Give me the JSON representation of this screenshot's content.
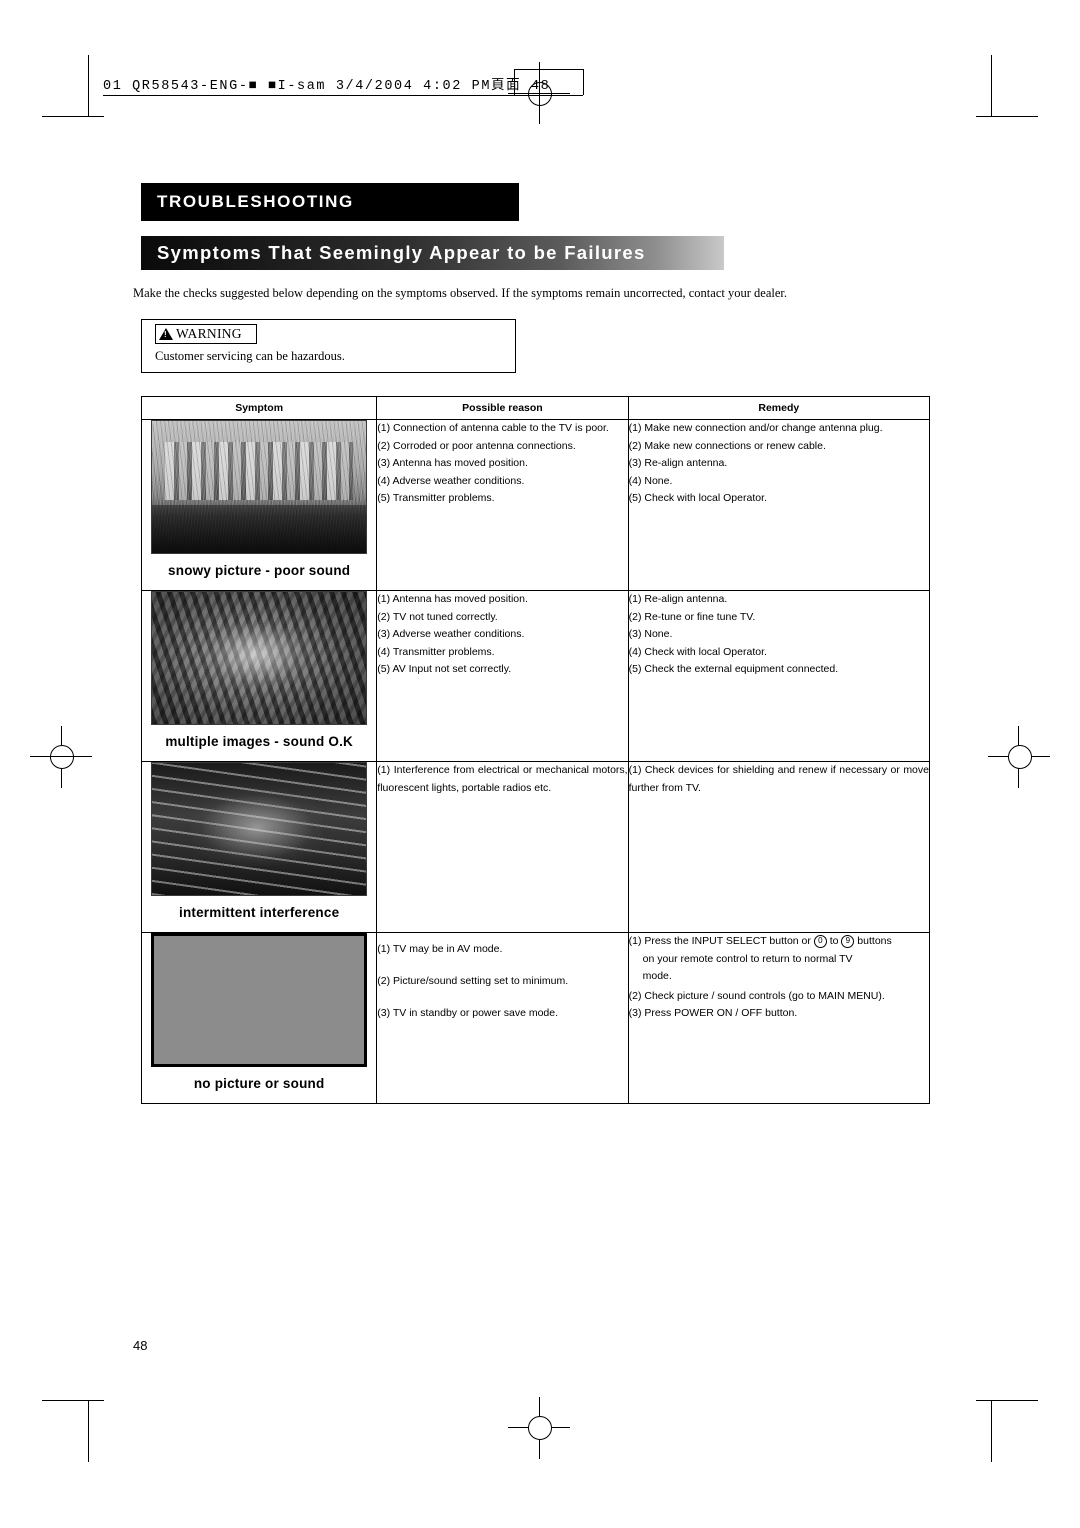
{
  "header": {
    "file_line": "01 QR58543-ENG-■ ■I-sam 3/4/2004 4:02 PM頁面 48"
  },
  "titles": {
    "section": "TROUBLESHOOTING",
    "subsection": "Symptoms That Seemingly Appear to be Failures"
  },
  "intro": "Make the checks suggested below depending on the symptoms observed.  If the symptoms remain uncorrected, contact your dealer.",
  "warning": {
    "label": "WARNING",
    "text": "Customer servicing can be hazardous."
  },
  "table": {
    "headers": [
      "Symptom",
      "Possible reason",
      "Remedy"
    ],
    "rows": [
      {
        "thumb": "snowy-picture-thumbnail",
        "caption": "snowy picture - poor sound",
        "reasons": [
          "(1) Connection of antenna cable to the TV is poor.",
          "(2) Corroded or poor antenna connections.",
          "(3) Antenna has moved position.",
          "(4) Adverse weather conditions.",
          "(5) Transmitter problems."
        ],
        "remedies": [
          "(1) Make new connection and/or change antenna plug.",
          "(2) Make new connections or renew cable.",
          "(3) Re-align antenna.",
          "(4) None.",
          "(5) Check with local Operator."
        ]
      },
      {
        "thumb": "multiple-images-thumbnail",
        "caption": "multiple images - sound O.K",
        "reasons": [
          "(1) Antenna has moved position.",
          "(2) TV not tuned correctly.",
          "(3) Adverse weather conditions.",
          "(4) Transmitter problems.",
          "(5) AV Input not set correctly."
        ],
        "remedies": [
          "(1) Re-align antenna.",
          "(2) Re-tune or fine tune TV.",
          "(3) None.",
          "(4) Check with local Operator.",
          "(5) Check the external equipment connected."
        ]
      },
      {
        "thumb": "intermittent-interference-thumbnail",
        "caption": "intermittent interference",
        "reasons": [
          "(1) Interference from electrical or mechanical motors, fluorescent lights, portable radios etc."
        ],
        "remedies": [
          "(1) Check devices for shielding and renew if necessary or move further from TV."
        ]
      },
      {
        "thumb": "no-picture-thumbnail",
        "caption": "no picture or sound",
        "reasons": [
          "(1) TV may be in AV mode.",
          "(2) Picture/sound setting set to minimum.",
          "(3) TV in standby or power save mode."
        ],
        "remedies": [
          "(1) Press the INPUT SELECT button or 0 to 9 buttons on your remote control to return to normal TV mode.",
          "(2) Check picture / sound controls (go to  MAIN MENU).",
          "(3) Press POWER ON / OFF button."
        ],
        "remedy1_parts": {
          "pre": "(1) Press the INPUT SELECT button or ",
          "digit_a": "0",
          "mid": " to ",
          "digit_b": "9",
          "post": " buttons",
          "line2": "on your remote control to return to normal TV",
          "line3": "mode."
        }
      }
    ]
  },
  "footer": {
    "page_number": "48"
  }
}
